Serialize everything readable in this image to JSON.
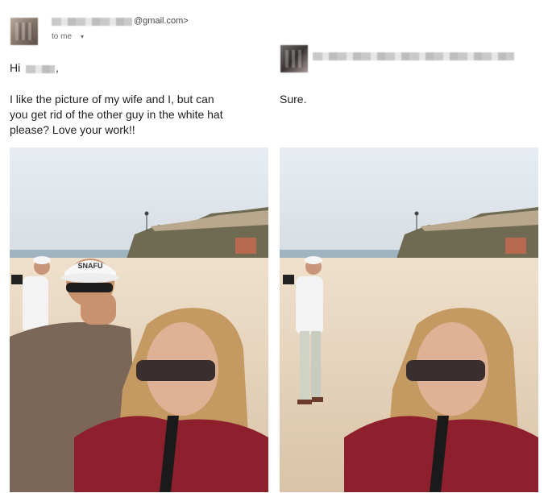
{
  "email": {
    "sender_domain": "@gmail.com>",
    "to_me": "to me",
    "to_me_caret": "▾",
    "greeting": "Hi",
    "greeting_comma": ",",
    "message_lines": [
      "I like the picture of my wife and I,  but can",
      "you get rid of the other guy in the white hat",
      "please? Love your work!!"
    ]
  },
  "reply": {
    "message": "Sure."
  },
  "photos": {
    "original_hat_text": "SNAFU"
  },
  "colors": {
    "sky": "#dfe5ea",
    "sand": "#e6d3bd",
    "shirt_red": "#8e1f2c",
    "hair_blonde": "#c49a62"
  }
}
